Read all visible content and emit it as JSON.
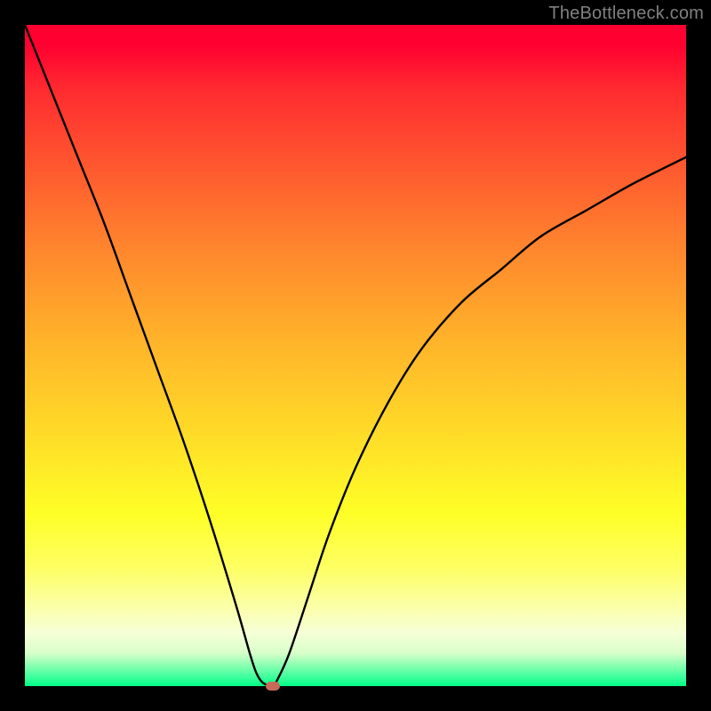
{
  "watermark": "TheBottleneck.com",
  "chart_data": {
    "type": "line",
    "title": "",
    "xlabel": "",
    "ylabel": "",
    "xlim": [
      0,
      100
    ],
    "ylim": [
      0,
      100
    ],
    "grid": false,
    "series": [
      {
        "name": "curve",
        "x": [
          0,
          4,
          8,
          12,
          16,
          20,
          24,
          28,
          32,
          34,
          35,
          36,
          37.5,
          38,
          40,
          43,
          46,
          50,
          55,
          60,
          66,
          72,
          78,
          85,
          92,
          100
        ],
        "y": [
          100,
          90,
          80,
          70,
          59,
          48,
          37,
          25,
          12,
          5,
          2,
          0.5,
          0,
          0.6,
          5,
          14,
          23,
          33,
          43,
          51,
          58,
          63,
          68,
          72,
          76,
          80
        ]
      }
    ],
    "marker": {
      "x": 37.5,
      "y": 0
    },
    "gradient_stops": [
      {
        "pos": 0,
        "color": "#ff0030"
      },
      {
        "pos": 0.25,
        "color": "#ff6a2e"
      },
      {
        "pos": 0.5,
        "color": "#ffc028"
      },
      {
        "pos": 0.75,
        "color": "#feff27"
      },
      {
        "pos": 0.92,
        "color": "#f6ffd8"
      },
      {
        "pos": 1.0,
        "color": "#00ff88"
      }
    ]
  }
}
